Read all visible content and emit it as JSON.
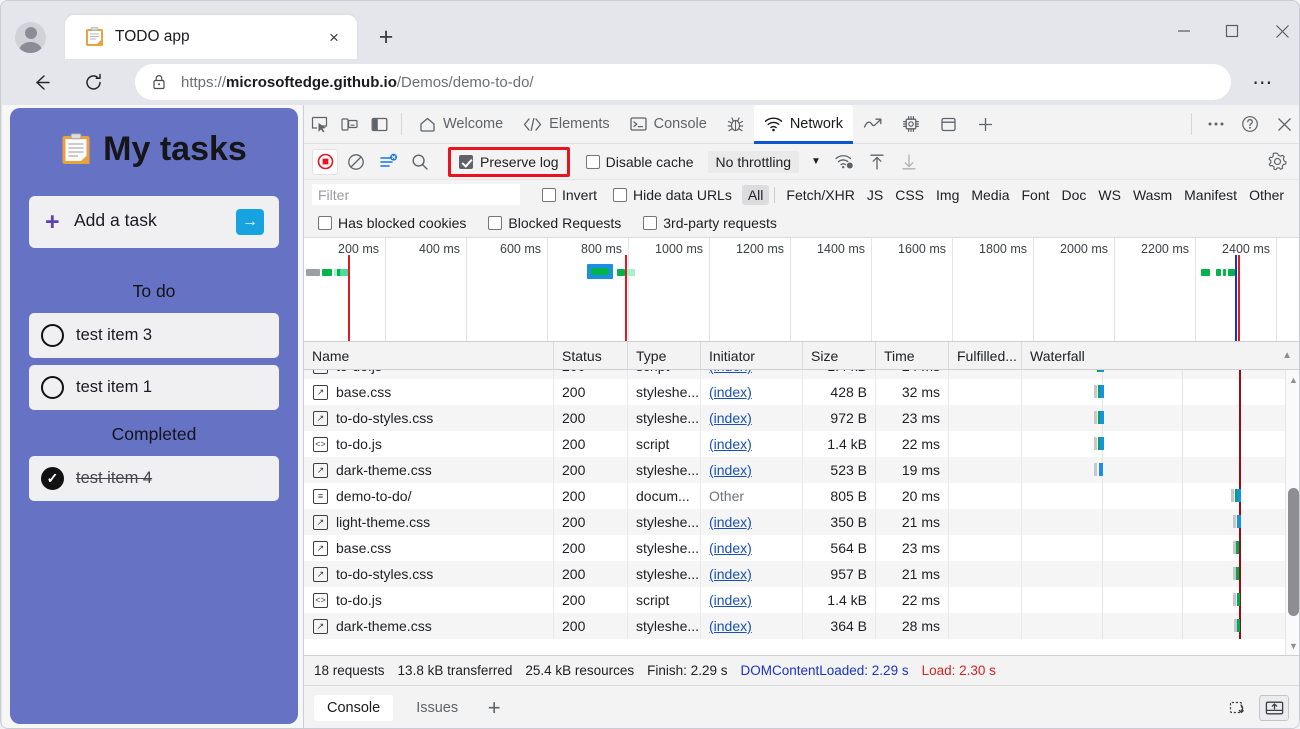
{
  "browser": {
    "tab": {
      "title": "TODO app",
      "favicon": "clipboard-icon",
      "close_label": "×"
    },
    "new_tab_label": "+",
    "window_controls": {
      "minimize": "—",
      "maximize": "□",
      "close": "✕"
    },
    "nav": {
      "back": "←",
      "reload": "↻",
      "more": "⋯"
    },
    "address": {
      "scheme": "https://",
      "host": "microsoftedge.github.io",
      "path": "/Demos/demo-to-do/",
      "lock": "lock-icon"
    }
  },
  "todo_app": {
    "title": "My tasks",
    "add_task": {
      "label": "Add a task",
      "plus": "+",
      "submit": "→"
    },
    "sections": [
      {
        "heading": "To do",
        "tasks": [
          {
            "label": "test item 3",
            "done": false
          },
          {
            "label": "test item 1",
            "done": false
          }
        ]
      },
      {
        "heading": "Completed",
        "tasks": [
          {
            "label": "test item 4",
            "done": true
          }
        ]
      }
    ]
  },
  "devtools": {
    "left_icons": [
      "inspect-element-icon",
      "device-emulation-icon",
      "dock-side-icon"
    ],
    "tabs": [
      {
        "label": "Welcome",
        "icon": "home-icon",
        "active": false
      },
      {
        "label": "Elements",
        "icon": "code-brackets-icon",
        "active": false
      },
      {
        "label": "Console",
        "icon": "terminal-icon",
        "active": false
      },
      {
        "label": "",
        "icon": "bug-sources-icon",
        "active": false
      },
      {
        "label": "Network",
        "icon": "network-wifi-icon",
        "active": true
      },
      {
        "label": "",
        "icon": "performance-gauge-icon",
        "active": false
      },
      {
        "label": "",
        "icon": "memory-chip-icon",
        "active": false
      },
      {
        "label": "",
        "icon": "application-storage-icon",
        "active": false
      },
      {
        "label": "",
        "icon": "more-tools-plus-icon",
        "active": false
      }
    ],
    "tab_right": [
      "more-options-icon",
      "help-question-icon",
      "close-devtools-icon"
    ],
    "accent_color": "#0b57d0",
    "highlight_color": "#e8131e",
    "network_toolbar": {
      "record_button": "record-stop-icon",
      "clear_button": "clear-icon",
      "filter_toggle": "filter-icon",
      "search_button": "search-icon",
      "preserve_log": {
        "label": "Preserve log",
        "checked": true,
        "highlighted": true
      },
      "disable_cache": {
        "label": "Disable cache",
        "checked": false
      },
      "throttling": {
        "value": "No throttling",
        "caret": "▼"
      },
      "extra_icons": [
        "network-conditions-icon",
        "import-har-icon",
        "export-har-icon"
      ],
      "settings": "gear-icon"
    },
    "filter_bar": {
      "placeholder": "Filter",
      "value": "",
      "invert": {
        "label": "Invert",
        "checked": false
      },
      "hide_data_urls": {
        "label": "Hide data URLs",
        "checked": false
      },
      "types": [
        "All",
        "Fetch/XHR",
        "JS",
        "CSS",
        "Img",
        "Media",
        "Font",
        "Doc",
        "WS",
        "Wasm",
        "Manifest",
        "Other"
      ],
      "selected_type": "All"
    },
    "blocked_bar": [
      {
        "label": "Has blocked cookies",
        "checked": false
      },
      {
        "label": "Blocked Requests",
        "checked": false
      },
      {
        "label": "3rd-party requests",
        "checked": false
      }
    ],
    "overview": {
      "ticks": [
        "200 ms",
        "400 ms",
        "600 ms",
        "800 ms",
        "1000 ms",
        "1200 ms",
        "1400 ms",
        "1600 ms",
        "1800 ms",
        "2000 ms",
        "2200 ms",
        "2400 ms"
      ]
    },
    "table": {
      "columns": [
        "Name",
        "Status",
        "Type",
        "Initiator",
        "Size",
        "Time",
        "Fulfilled...",
        "Waterfall"
      ],
      "sort_indicator": "▲",
      "rows": [
        {
          "name": "base.css",
          "icon": "stylesheet-icon",
          "status": "200",
          "type": "styleshe...",
          "initiator": "(index)",
          "initiator_link": true,
          "size": "428 B",
          "time": "32 ms",
          "fulfilled": ""
        },
        {
          "name": "to-do-styles.css",
          "icon": "stylesheet-icon",
          "status": "200",
          "type": "styleshe...",
          "initiator": "(index)",
          "initiator_link": true,
          "size": "972 B",
          "time": "23 ms",
          "fulfilled": ""
        },
        {
          "name": "to-do.js",
          "icon": "script-icon",
          "status": "200",
          "type": "script",
          "initiator": "(index)",
          "initiator_link": true,
          "size": "1.4 kB",
          "time": "22 ms",
          "fulfilled": ""
        },
        {
          "name": "dark-theme.css",
          "icon": "stylesheet-icon",
          "status": "200",
          "type": "styleshe...",
          "initiator": "(index)",
          "initiator_link": true,
          "size": "523 B",
          "time": "19 ms",
          "fulfilled": ""
        },
        {
          "name": "demo-to-do/",
          "icon": "document-icon",
          "status": "200",
          "type": "docum...",
          "initiator": "Other",
          "initiator_link": false,
          "size": "805 B",
          "time": "20 ms",
          "fulfilled": ""
        },
        {
          "name": "light-theme.css",
          "icon": "stylesheet-icon",
          "status": "200",
          "type": "styleshe...",
          "initiator": "(index)",
          "initiator_link": true,
          "size": "350 B",
          "time": "21 ms",
          "fulfilled": ""
        },
        {
          "name": "base.css",
          "icon": "stylesheet-icon",
          "status": "200",
          "type": "styleshe...",
          "initiator": "(index)",
          "initiator_link": true,
          "size": "564 B",
          "time": "23 ms",
          "fulfilled": ""
        },
        {
          "name": "to-do-styles.css",
          "icon": "stylesheet-icon",
          "status": "200",
          "type": "styleshe...",
          "initiator": "(index)",
          "initiator_link": true,
          "size": "957 B",
          "time": "21 ms",
          "fulfilled": ""
        },
        {
          "name": "to-do.js",
          "icon": "script-icon",
          "status": "200",
          "type": "script",
          "initiator": "(index)",
          "initiator_link": true,
          "size": "1.4 kB",
          "time": "22 ms",
          "fulfilled": ""
        },
        {
          "name": "dark-theme.css",
          "icon": "stylesheet-icon",
          "status": "200",
          "type": "styleshe...",
          "initiator": "(index)",
          "initiator_link": true,
          "size": "364 B",
          "time": "28 ms",
          "fulfilled": ""
        }
      ]
    },
    "summary": {
      "requests": "18 requests",
      "transferred": "13.8 kB transferred",
      "resources": "25.4 kB resources",
      "finish": "Finish: 2.29 s",
      "dom_content_loaded": "DOMContentLoaded: 2.29 s",
      "load": "Load: 2.30 s"
    },
    "drawer": {
      "tabs": [
        {
          "label": "Console",
          "active": true
        },
        {
          "label": "Issues",
          "active": false
        }
      ],
      "plus": "+",
      "right_icons": [
        "restore-drawer-icon",
        "dock-bottom-icon"
      ]
    }
  }
}
